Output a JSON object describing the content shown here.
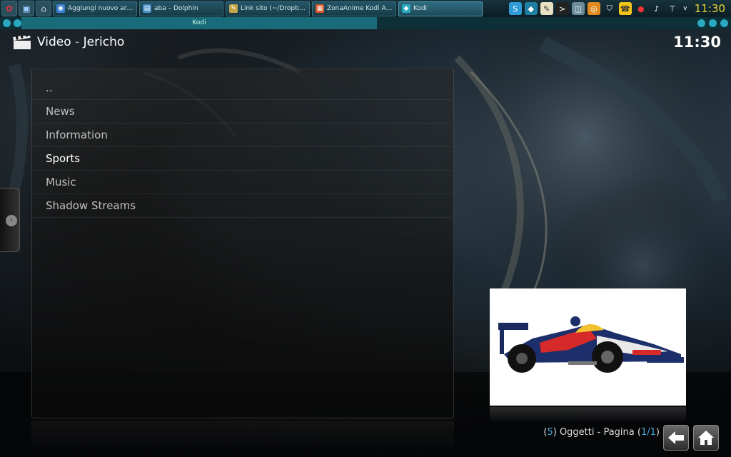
{
  "taskbar": {
    "tasks": [
      {
        "label": "Aggiungi nuovo artico...",
        "icon_color": "#3a7fd0"
      },
      {
        "label": "aba – Dolphin",
        "icon_color": "#4a90c8"
      },
      {
        "label": "Link sito (~/Dropbox/S...",
        "icon_color": "#c7a44a"
      },
      {
        "label": "ZonaAnime Kodi Add-...",
        "icon_color": "#d9582a"
      },
      {
        "label": "Kodi",
        "icon_color": "#2aa8c0"
      }
    ],
    "clock": "11:30"
  },
  "window": {
    "title": "Kodi"
  },
  "header": {
    "section": "Video",
    "separator": "-",
    "addon": "Jericho",
    "clock": "11:30"
  },
  "list": {
    "items": [
      "..",
      "News",
      "Information",
      "Sports",
      "Music",
      "Shadow Streams"
    ],
    "focused_index": 3
  },
  "footer": {
    "count": "5",
    "items_word": "Oggetti",
    "page_word": "Pagina",
    "page_current": "1",
    "page_total": "1"
  },
  "colors": {
    "accent": "#4aa6d9",
    "clock_tray": "#e9d335",
    "taskbar_title": "#1a6b79"
  },
  "icons": {
    "header": "clapperboard-icon",
    "back": "back-arrow-icon",
    "home": "home-icon"
  }
}
